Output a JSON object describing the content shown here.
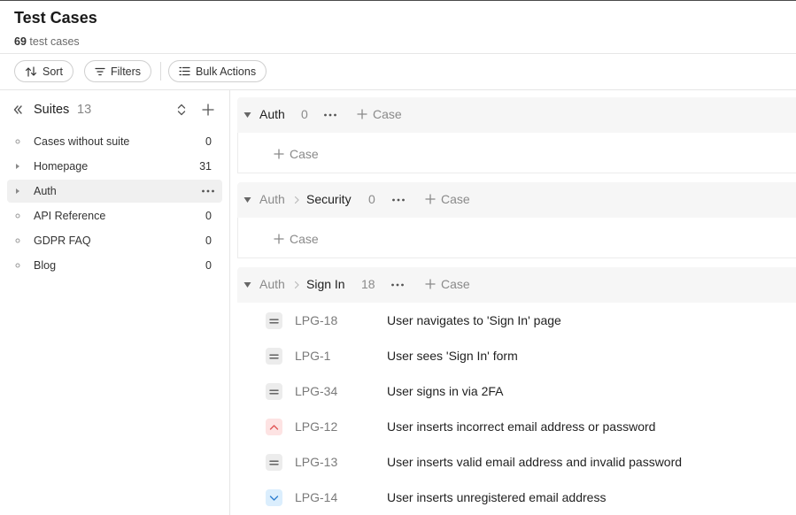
{
  "header": {
    "title": "Test Cases",
    "count": "69",
    "count_suffix": "test cases"
  },
  "toolbar": {
    "sort_label": "Sort",
    "filters_label": "Filters",
    "bulk_label": "Bulk Actions"
  },
  "sidebar": {
    "title": "Suites",
    "count": "13",
    "items": [
      {
        "label": "Cases without suite",
        "count": "0",
        "mark": "circle"
      },
      {
        "label": "Homepage",
        "count": "31",
        "mark": "triangle"
      },
      {
        "label": "Auth",
        "count": "",
        "mark": "triangle",
        "active": true
      },
      {
        "label": "API Reference",
        "count": "0",
        "mark": "circle"
      },
      {
        "label": "GDPR FAQ",
        "count": "0",
        "mark": "circle"
      },
      {
        "label": "Blog",
        "count": "0",
        "mark": "circle"
      }
    ]
  },
  "groups": [
    {
      "parent": "",
      "name": "Auth",
      "count": "0",
      "add_label": "Case",
      "body_add_label": "Case"
    },
    {
      "parent": "Auth",
      "name": "Security",
      "count": "0",
      "add_label": "Case",
      "body_add_label": "Case"
    },
    {
      "parent": "Auth",
      "name": "Sign In",
      "count": "18",
      "add_label": "Case"
    }
  ],
  "cases": [
    {
      "id": "LPG-18",
      "title": "User navigates to 'Sign In' page",
      "priority": "normal"
    },
    {
      "id": "LPG-1",
      "title": "User sees 'Sign In' form",
      "priority": "normal"
    },
    {
      "id": "LPG-34",
      "title": "User signs in via 2FA",
      "priority": "normal"
    },
    {
      "id": "LPG-12",
      "title": "User inserts incorrect email address or password",
      "priority": "high"
    },
    {
      "id": "LPG-13",
      "title": "User inserts valid email address and invalid password",
      "priority": "normal"
    },
    {
      "id": "LPG-14",
      "title": "User inserts unregistered email address",
      "priority": "low"
    }
  ],
  "colors": {
    "priority_high": "#e05555",
    "priority_low": "#2f7fd0",
    "priority_normal": "#555555",
    "active_row": "#f0f0f0"
  }
}
